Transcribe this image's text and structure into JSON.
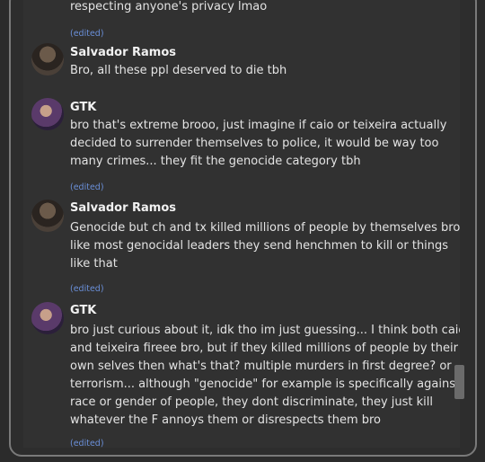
{
  "messages": [
    {
      "id": "top",
      "lines": [
        "respecting anyone's privacy lmao"
      ],
      "edited": "(edited)"
    },
    {
      "author": "Salvador Ramos",
      "avatar_icon": "avatar-icon",
      "lines": [
        "Bro, all these ppl deserved to die tbh"
      ]
    },
    {
      "author": "GTK",
      "avatar_icon": "avatar-icon",
      "lines": [
        "bro that's extreme brooo, just imagine if caio or teixeira actually",
        "decided to surrender themselves to police, it would be way too",
        "many crimes... they fit the genocide category tbh"
      ],
      "edited": "(edited)"
    },
    {
      "author": "Salvador Ramos",
      "avatar_icon": "avatar-icon",
      "lines": [
        "Genocide but ch and tx killed millions of people by themselves bro...",
        "like most genocidal leaders they send henchmen to kill or things",
        "like that"
      ],
      "edited": "(edited)"
    },
    {
      "author": "GTK",
      "avatar_icon": "avatar-icon",
      "lines": [
        "bro just curious about it, idk tho im just guessing... I think both caio",
        "and teixeira fireee bro, but if they killed millions of people by their",
        "own selves then what's that? multiple murders in first degree? or",
        "terrorism... although \"genocide\" for example is specifically against a",
        "race or gender of people, they dont discriminate, they just kill",
        "whatever the F annoys them or disrespects them bro"
      ],
      "edited": "(edited)"
    }
  ]
}
